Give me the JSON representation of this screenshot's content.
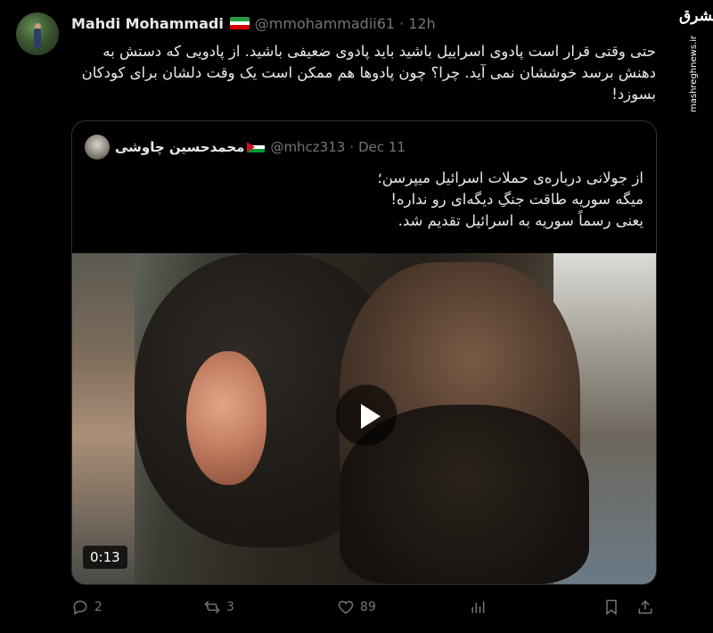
{
  "tweet": {
    "author_name": "Mahdi Mohammadi",
    "author_handle": "@mmohammadii61",
    "time": "12h",
    "text": "حتی وقتی قرار است پادوی اسراییل باشید باید پادوی ضعیفی باشید. از پادویی که دستش به دهنش برسد خوششان نمی آید. چرا؟ چون پادوها هم ممکن است یک وقت دلشان برای کودکان بسوزد!",
    "flag_colors": [
      "#239f40",
      "#ffffff",
      "#da0000"
    ]
  },
  "quote": {
    "author_name": "محمدحسین چاوشی",
    "author_handle": "@mhcz313",
    "date": "Dec 11",
    "lines": [
      "از جولانی درباره‌ی حملات اسرائیل میپرسن؛",
      "میگه سوریه طاقت جنگِ دیگه‌ای رو نداره!",
      "یعنی رسماً سوریه به اسرائیل تقدیم شد."
    ],
    "flag_colors": [
      "#000000",
      "#ffffff",
      "#009736",
      "#ce1126"
    ],
    "video_duration": "0:13"
  },
  "actions": {
    "reply_count": "2",
    "retweet_count": "3",
    "like_count": "89"
  },
  "watermark": {
    "logo": "مشرق",
    "site": "mashreghnews.ir"
  },
  "icons": [
    "reply-icon",
    "retweet-icon",
    "like-icon",
    "views-icon",
    "bookmark-icon",
    "share-icon",
    "play-icon"
  ]
}
